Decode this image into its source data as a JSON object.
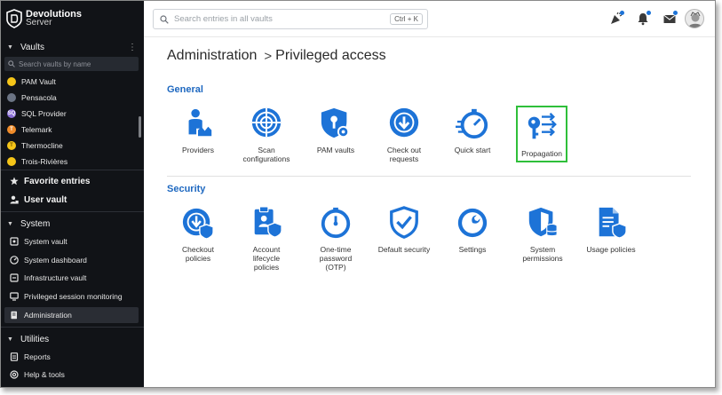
{
  "brand": {
    "name": "Devolutions",
    "sub": "Server"
  },
  "sidebar": {
    "vaults_header": "Vaults",
    "search_placeholder": "Search vaults by name",
    "vaults": [
      {
        "label": "PAM Vault",
        "color": "#f5c518",
        "letter": ""
      },
      {
        "label": "Pensacola",
        "color": "#6b7484",
        "letter": ""
      },
      {
        "label": "SQL Provider",
        "color": "#8b6fd6",
        "letter": "SQ"
      },
      {
        "label": "Telemark",
        "color": "#f08c2a",
        "letter": "T"
      },
      {
        "label": "Thermocline",
        "color": "#f5c518",
        "letter": "T"
      },
      {
        "label": "Trois-Rivières",
        "color": "#f5c518",
        "letter": ""
      }
    ],
    "favorite_entries": "Favorite entries",
    "user_vault": "User vault",
    "system_header": "System",
    "system_items": [
      {
        "label": "System vault"
      },
      {
        "label": "System dashboard"
      },
      {
        "label": "Infrastructure vault"
      },
      {
        "label": "Privileged session monitoring"
      },
      {
        "label": "Administration"
      }
    ],
    "utilities_header": "Utilities",
    "utilities_items": [
      {
        "label": "Reports"
      },
      {
        "label": "Help & tools"
      }
    ]
  },
  "topbar": {
    "search_placeholder": "Search entries in all vaults",
    "shortcut": "Ctrl + K"
  },
  "main": {
    "breadcrumb_root": "Administration",
    "breadcrumb_sep": ">",
    "breadcrumb_current": "Privileged access",
    "general_title": "General",
    "general_tiles": [
      {
        "label": "Providers",
        "icon": "providers-icon"
      },
      {
        "label": "Scan configurations",
        "icon": "scan-icon"
      },
      {
        "label": "PAM vaults",
        "icon": "pam-vault-icon"
      },
      {
        "label": "Check out requests",
        "icon": "checkout-request-icon"
      },
      {
        "label": "Quick start",
        "icon": "quick-start-icon"
      },
      {
        "label": "Propagation",
        "icon": "propagation-icon",
        "selected": true
      }
    ],
    "security_title": "Security",
    "security_tiles": [
      {
        "label": "Checkout policies",
        "icon": "checkout-policy-icon"
      },
      {
        "label": "Account lifecycle policies",
        "icon": "lifecycle-icon"
      },
      {
        "label": "One-time password (OTP)",
        "icon": "otp-icon"
      },
      {
        "label": "Default security",
        "icon": "shield-check-icon"
      },
      {
        "label": "Settings",
        "icon": "wrench-icon"
      },
      {
        "label": "System permissions",
        "icon": "permissions-icon"
      },
      {
        "label": "Usage policies",
        "icon": "usage-policy-icon"
      }
    ]
  },
  "colors": {
    "accent": "#1d73d7",
    "selected_border": "#2fbf3a",
    "sidebar_bg": "#111317"
  }
}
